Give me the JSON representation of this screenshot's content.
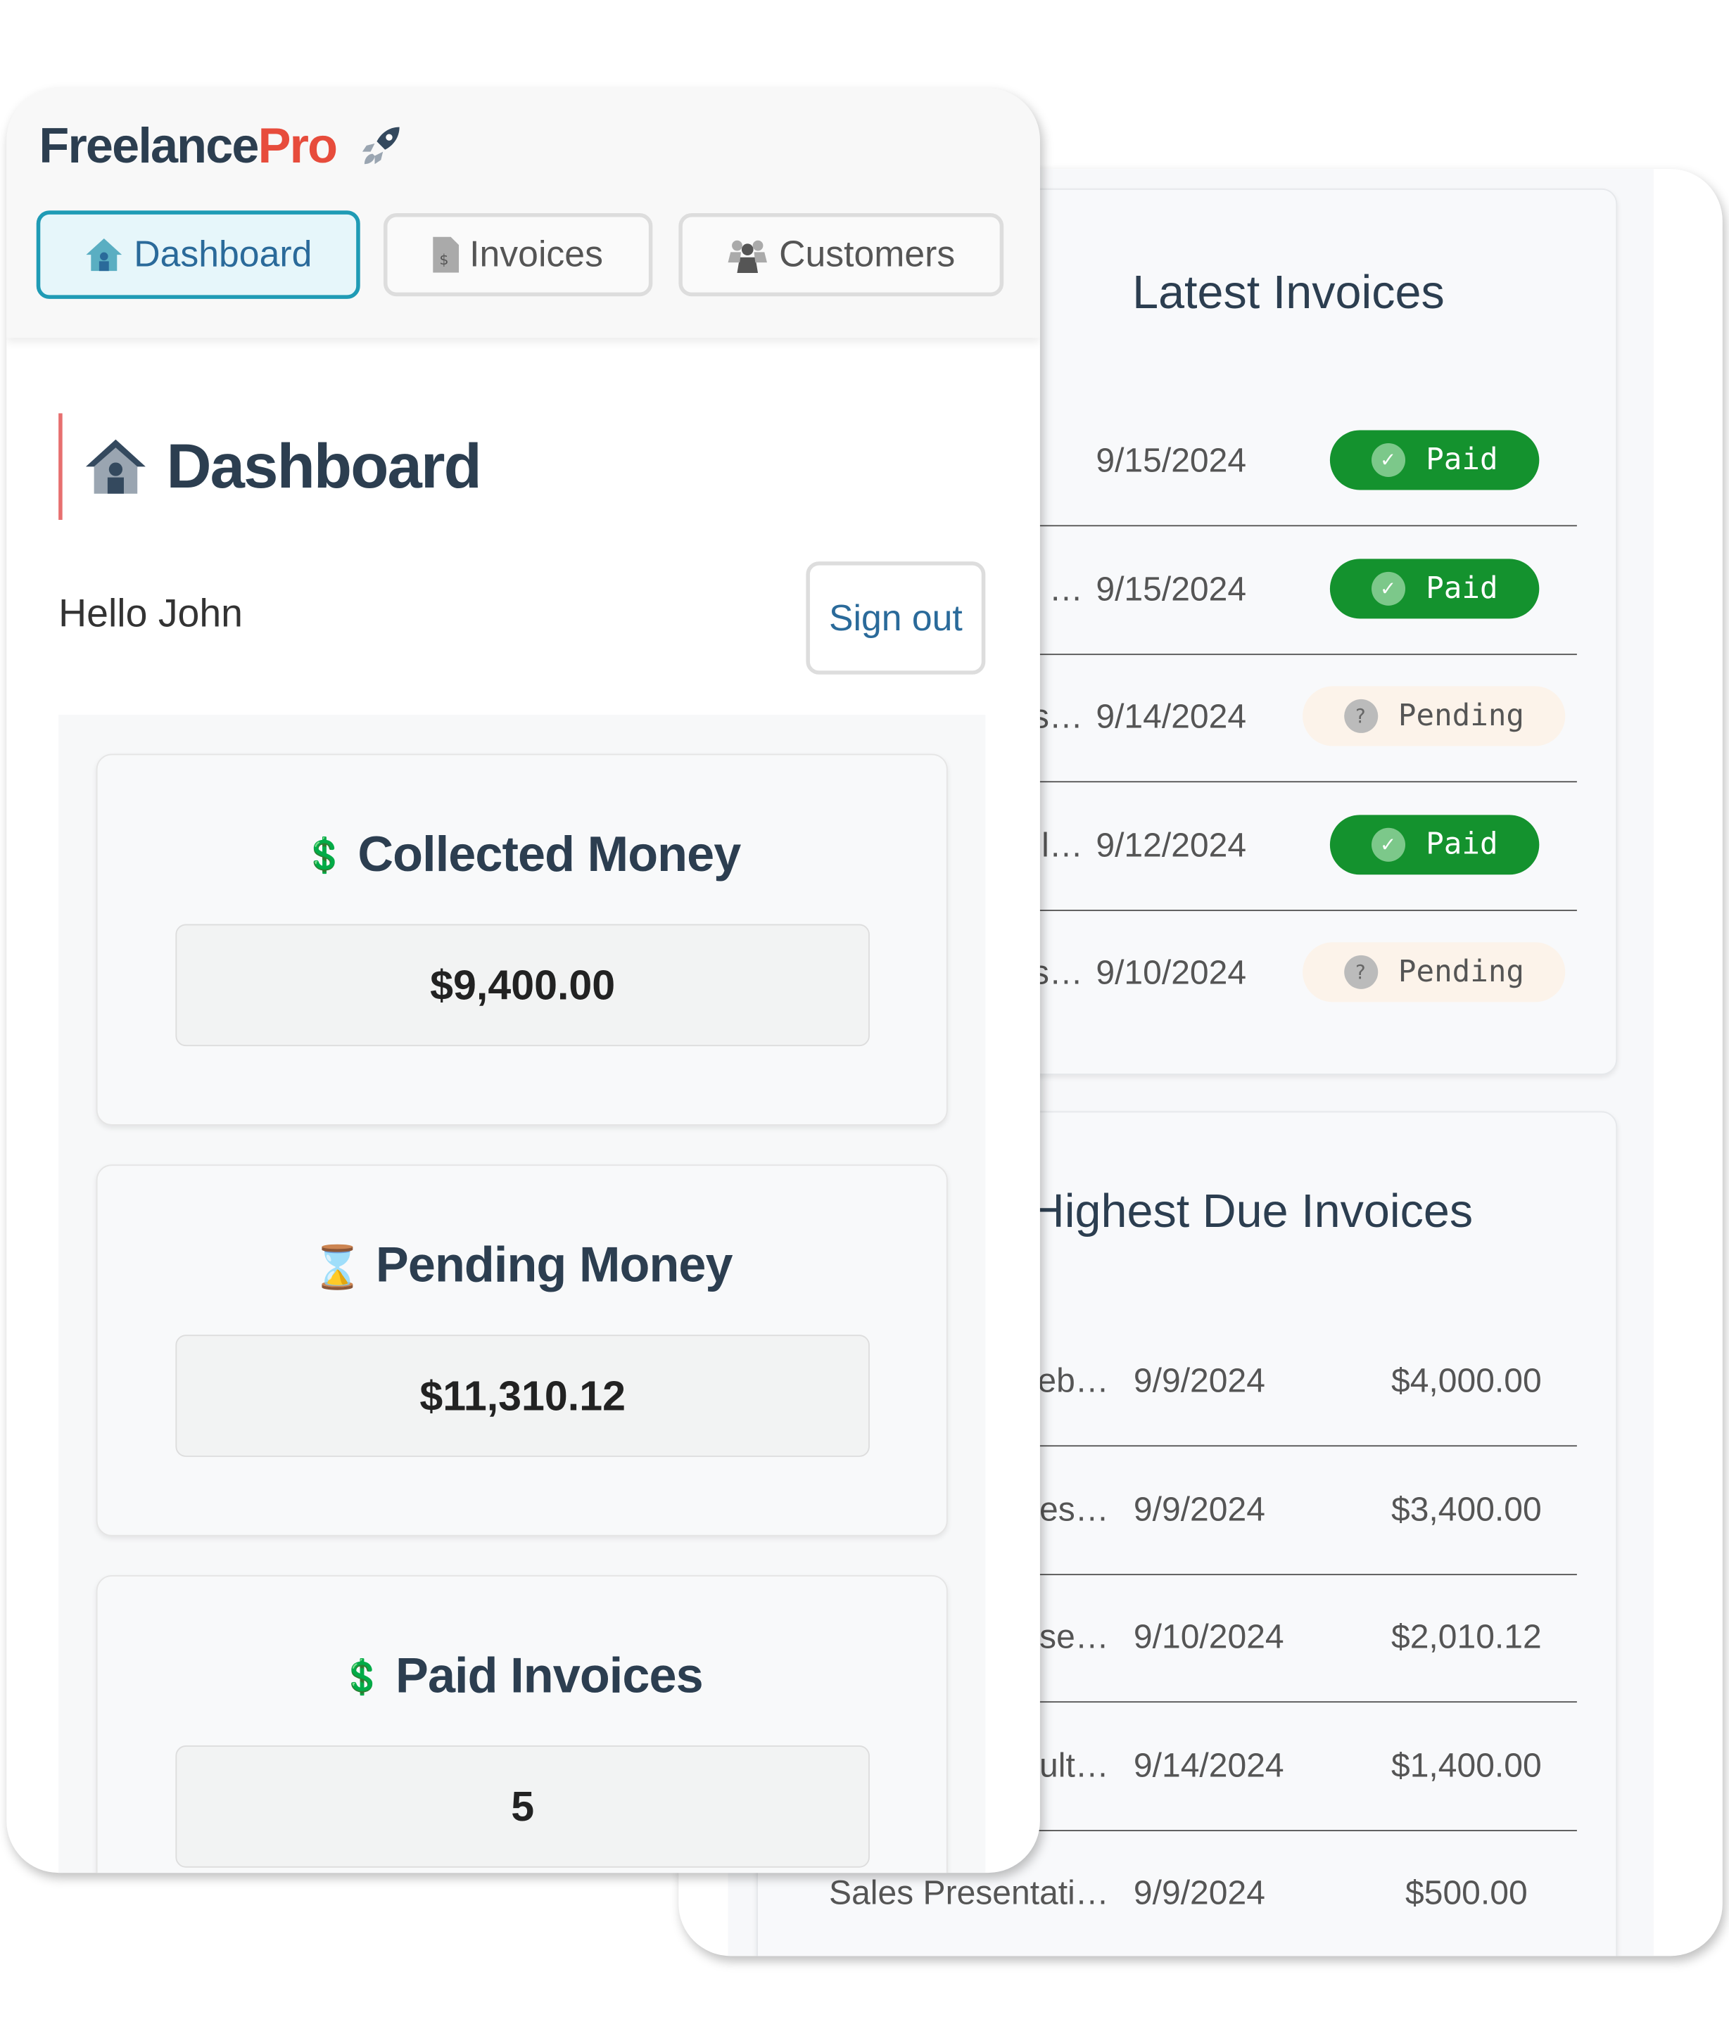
{
  "app": {
    "logo_main": "Freelance",
    "logo_accent": "Pro"
  },
  "nav": {
    "tabs": [
      {
        "label": "Dashboard",
        "icon": "house-icon",
        "active": true
      },
      {
        "label": "Invoices",
        "icon": "invoice-icon"
      },
      {
        "label": "Customers",
        "icon": "users-icon"
      }
    ]
  },
  "page": {
    "title": "Dashboard",
    "greeting": "Hello John",
    "sign_out": "Sign out"
  },
  "stats": [
    {
      "title": "Collected Money",
      "icon": "hand-dollar-icon",
      "value": "$9,400.00"
    },
    {
      "title": "Pending Money",
      "icon": "hourglass-icon",
      "value": "$11,310.12"
    },
    {
      "title": "Paid Invoices",
      "icon": "hand-dollar-icon",
      "value": "5"
    }
  ],
  "latest": {
    "title": "Latest Invoices",
    "rows": [
      {
        "name": "",
        "date": "9/15/2024",
        "status": "Paid"
      },
      {
        "name": "…",
        "date": "9/15/2024",
        "status": "Paid"
      },
      {
        "name": "s…",
        "date": "9/14/2024",
        "status": "Pending"
      },
      {
        "name": "l…",
        "date": "9/12/2024",
        "status": "Paid"
      },
      {
        "name": "s…",
        "date": "9/10/2024",
        "status": "Pending"
      }
    ]
  },
  "highest": {
    "title": "Highest Due Invoices",
    "rows": [
      {
        "name": "eb…",
        "date": "9/9/2024",
        "amount": "$4,000.00"
      },
      {
        "name": "es…",
        "date": "9/9/2024",
        "amount": "$3,400.00"
      },
      {
        "name": "se…",
        "date": "9/10/2024",
        "amount": "$2,010.12"
      },
      {
        "name": "sult…",
        "date": "9/14/2024",
        "amount": "$1,400.00"
      },
      {
        "name": "Sales Presentati…",
        "date": "9/9/2024",
        "amount": "$500.00"
      }
    ]
  },
  "colors": {
    "accent": "#1f9bb5",
    "brand_red": "#e74c3c",
    "paid": "#14922e",
    "pending_bg": "#fcf3ea",
    "heading": "#2c3e50"
  }
}
